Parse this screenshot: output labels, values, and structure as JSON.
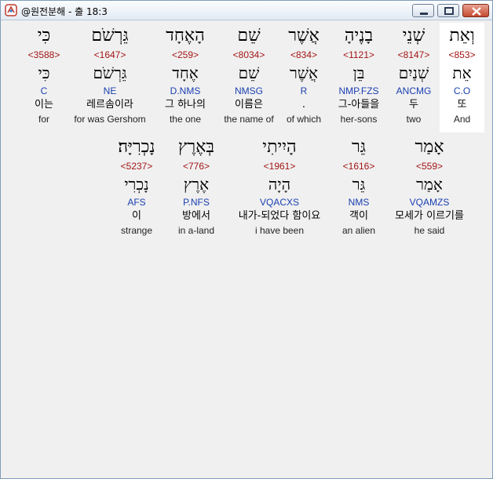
{
  "window": {
    "title": "@원전분해 - 출 18:3"
  },
  "line1": [
    {
      "heb": "וְאֵת",
      "strong": "<853>",
      "lex": "אֵת",
      "parse": "C.O",
      "ko": "또",
      "en": "And"
    },
    {
      "heb": "שְׁנֵי",
      "strong": "<8147>",
      "lex": "שְׁנַיִם",
      "parse": "ANCMG",
      "ko": "두",
      "en": "two"
    },
    {
      "heb": "בָנֶיהָ",
      "strong": "<1121>",
      "lex": "בֵּן",
      "parse": "NMP.FZS",
      "ko": "그-아들을",
      "en": "her-sons"
    },
    {
      "heb": "אֲשֶׁר",
      "strong": "<834>",
      "lex": "אֲשֶׁר",
      "parse": "R",
      "ko": ".",
      "en": "of which"
    },
    {
      "heb": "שֵׁם",
      "strong": "<8034>",
      "lex": "שֵׁם",
      "parse": "NMSG",
      "ko": "이름은",
      "en": "the name of"
    },
    {
      "heb": "הָאֶחָד",
      "strong": "<259>",
      "lex": "אֶחָד",
      "parse": "D.NMS",
      "ko": "그 하나의",
      "en": "the one"
    },
    {
      "heb": "גֵּרְשֹׁם",
      "strong": "<1647>",
      "lex": "גֵּרְשֹׁם",
      "parse": "NE",
      "ko": "레르솜이라",
      "en": "for was Gershom"
    },
    {
      "heb": "כִּי",
      "strong": "<3588>",
      "lex": "כִּי",
      "parse": "C",
      "ko": "이는",
      "en": "for"
    }
  ],
  "line2": [
    {
      "heb": "אָמַר",
      "strong": "<559>",
      "lex": "אָמַר",
      "parse": "VQAMZS",
      "ko": "모세가 이르기를",
      "en": "he said"
    },
    {
      "heb": "גֵּר",
      "strong": "<1616>",
      "lex": "גֵּר",
      "parse": "NMS",
      "ko": "객이",
      "en": "an alien"
    },
    {
      "heb": "הָיִיתִי",
      "strong": "<1961>",
      "lex": "הָיָה",
      "parse": "VQACXS",
      "ko": "내가-되었다 함이요",
      "en": "i have been"
    },
    {
      "heb": "בְּאֶרֶץ",
      "strong": "<776>",
      "lex": "אֶרֶץ",
      "parse": "P.NFS",
      "ko": "방에서",
      "en": "in a-land"
    },
    {
      "heb": "נָכְרִיָּה׃",
      "strong": "<5237>",
      "lex": "נָכְרִי",
      "parse": "AFS",
      "ko": "이",
      "en": "strange"
    }
  ]
}
